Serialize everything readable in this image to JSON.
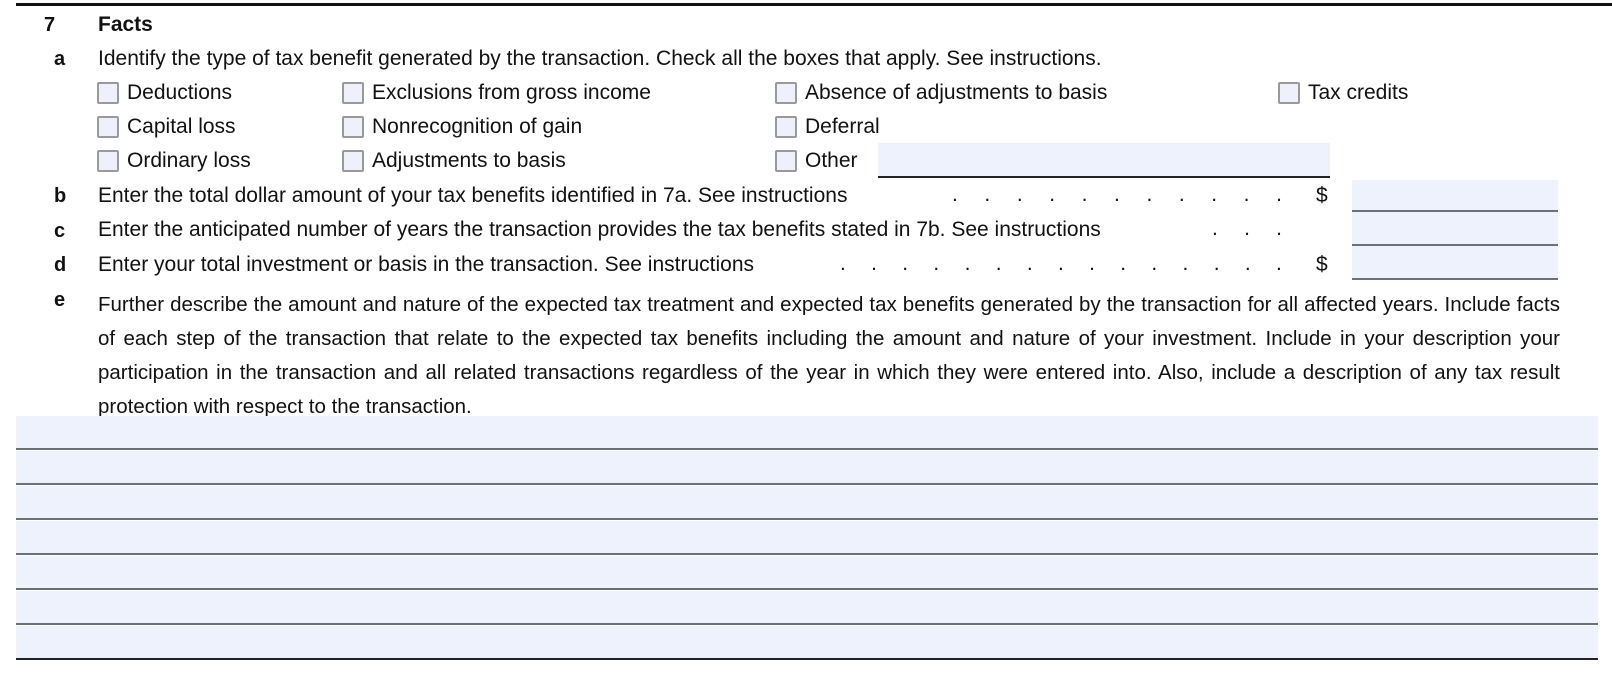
{
  "section": {
    "number": "7",
    "title": "Facts"
  },
  "line_a": {
    "letter": "a",
    "prompt": "Identify the type of tax benefit generated by the transaction. Check all the boxes that apply. See instructions.",
    "checkboxes": [
      {
        "label": "Deductions",
        "checked": false
      },
      {
        "label": "Exclusions from gross income",
        "checked": false
      },
      {
        "label": "Absence of adjustments to basis",
        "checked": false
      },
      {
        "label": "Tax credits",
        "checked": false
      },
      {
        "label": "Capital loss",
        "checked": false
      },
      {
        "label": "Nonrecognition of gain",
        "checked": false
      },
      {
        "label": "Deferral",
        "checked": false
      },
      {
        "label": "Ordinary loss",
        "checked": false
      },
      {
        "label": "Adjustments to basis",
        "checked": false
      },
      {
        "label": "Other",
        "checked": false
      }
    ],
    "other_value": ""
  },
  "line_b": {
    "letter": "b",
    "prompt": "Enter the total dollar amount of your tax benefits identified in 7a. See instructions",
    "currency": "$",
    "value": ""
  },
  "line_c": {
    "letter": "c",
    "prompt": "Enter the anticipated number of years the transaction provides the tax benefits stated in 7b. See instructions",
    "value": ""
  },
  "line_d": {
    "letter": "d",
    "prompt": "Enter your total investment or basis in the transaction. See instructions",
    "currency": "$",
    "value": ""
  },
  "line_e": {
    "letter": "e",
    "prompt": "Further describe the amount and nature of the expected tax treatment and expected tax benefits generated by the transaction for all affected years. Include facts of each step of the transaction that relate to the expected tax benefits including the amount and nature of your investment. Include in your description your participation in the transaction and all related transactions regardless of the year in which they were entered into. Also, include a description of any tax result protection with respect to the transaction.",
    "lines": [
      "",
      "",
      "",
      "",
      "",
      "",
      ""
    ]
  },
  "leader_dot": "."
}
